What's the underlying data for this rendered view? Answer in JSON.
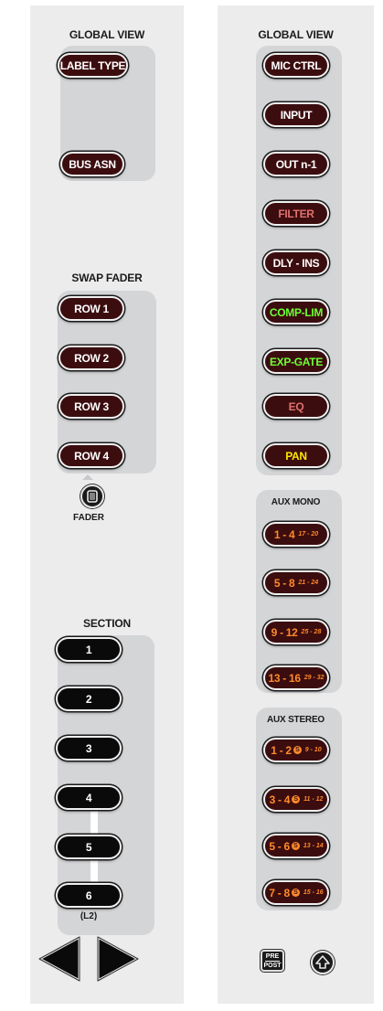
{
  "left": {
    "header": "GLOBAL VIEW",
    "global_view_buttons": [
      "LABEL TYPE",
      "BUS ASN"
    ],
    "swap_fader_header": "SWAP FADER",
    "swap_fader_buttons": [
      "ROW 1",
      "ROW 2",
      "ROW 3",
      "ROW 4"
    ],
    "fader_label": "FADER",
    "section_header": "SECTION",
    "section_buttons": [
      "1",
      "2",
      "3",
      "4",
      "5",
      "6"
    ],
    "section_footer": "(L2)"
  },
  "right": {
    "header": "GLOBAL VIEW",
    "buttons": [
      {
        "label": "MIC CTRL",
        "color": "#ffffff"
      },
      {
        "label": "INPUT",
        "color": "#ffffff"
      },
      {
        "label": "OUT n-1",
        "color": "#ffffff"
      },
      {
        "label": "FILTER",
        "color": "#e0706e"
      },
      {
        "label": "DLY - INS",
        "color": "#ffffff"
      },
      {
        "label": "COMP-LIM",
        "color": "#6cff35"
      },
      {
        "label": "EXP-GATE",
        "color": "#6cff35"
      },
      {
        "label": "EQ",
        "color": "#e0706e"
      },
      {
        "label": "PAN",
        "color": "#ffe600"
      }
    ],
    "aux_mono_header": "AUX MONO",
    "aux_mono": [
      {
        "main": "1 - 4",
        "sub": "17 - 20"
      },
      {
        "main": "5 - 8",
        "sub": "21 - 24"
      },
      {
        "main": "9 - 12",
        "sub": "25 - 28"
      },
      {
        "main": "13 - 16",
        "sub": "29 - 32"
      }
    ],
    "aux_stereo_header": "AUX STEREO",
    "aux_stereo": [
      {
        "main": "1 - 2",
        "sub": "9 - 10"
      },
      {
        "main": "3 - 4",
        "sub": "11 - 12"
      },
      {
        "main": "5 - 6",
        "sub": "13 - 14"
      },
      {
        "main": "7 - 8",
        "sub": "15 - 16"
      }
    ],
    "stereo_symbol": "S",
    "prepost": [
      "PRE",
      "POST"
    ]
  },
  "icons": {
    "fader_toggle": "fader-swap-icon",
    "prev": "left-arrow-icon",
    "next": "right-arrow-icon",
    "shift": "shift-up-icon"
  }
}
